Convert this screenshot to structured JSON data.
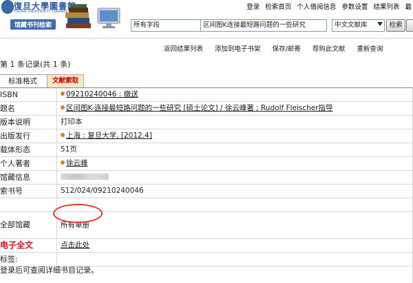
{
  "header": {
    "logo_cn": "復旦大學圖書館",
    "logo_en": "FUDAN UNIVERSITY LIBRARY",
    "subtitle": "馆藏书刊检索",
    "top_links": [
      "登录",
      "检索首页",
      "个人借阅信息",
      "参数设置",
      "结果列表",
      "最"
    ],
    "search": {
      "field_select": "所有字段",
      "query": "区间图K连接最短路问题的一些研究",
      "library_select": "中文文献库",
      "button": "检索"
    }
  },
  "actions": [
    "返回结果列表",
    "添加到电子书架",
    "保存/邮寄",
    "荐购此文献",
    "重新查询"
  ],
  "record_count": "第 1 条记录(共 1 条)",
  "tabs": {
    "standard": "标准格式",
    "export": "文献索取"
  },
  "record": {
    "isbn_label": "ISBN",
    "isbn_value": "09210240046 : 缴送",
    "title_label": "题名",
    "title_value": "区间图K-连接最短路问题的一些研究 [硕士论文] / 徐云峰著 ; Rudolf Fleischer指导",
    "edition_label": "版本说明",
    "edition_value": "打印本",
    "publisher_label": "出版发行",
    "publisher_value": "上海 : 复旦大学, [2012.4]",
    "physical_label": "载体形态",
    "physical_value": "51页",
    "author_label": "个人著者",
    "author_value": "徐云峰",
    "holdings_label": "馆藏信息",
    "callno_label": "索书号",
    "callno_value": "S12/024/09210240046",
    "all_holdings_label": "全部馆藏",
    "all_holdings_value": "所有单册",
    "fulltext_label": "电子全文",
    "fulltext_value": "点击此处",
    "tags_label": "标签:",
    "footer_note": "登录后可查阅详细书目记录。"
  },
  "colors": {
    "brand_blue": "#2a5c9c",
    "annotation_red": "#e0332a",
    "fulltext_red": "#d0111b",
    "bullet": "#c8861b"
  }
}
